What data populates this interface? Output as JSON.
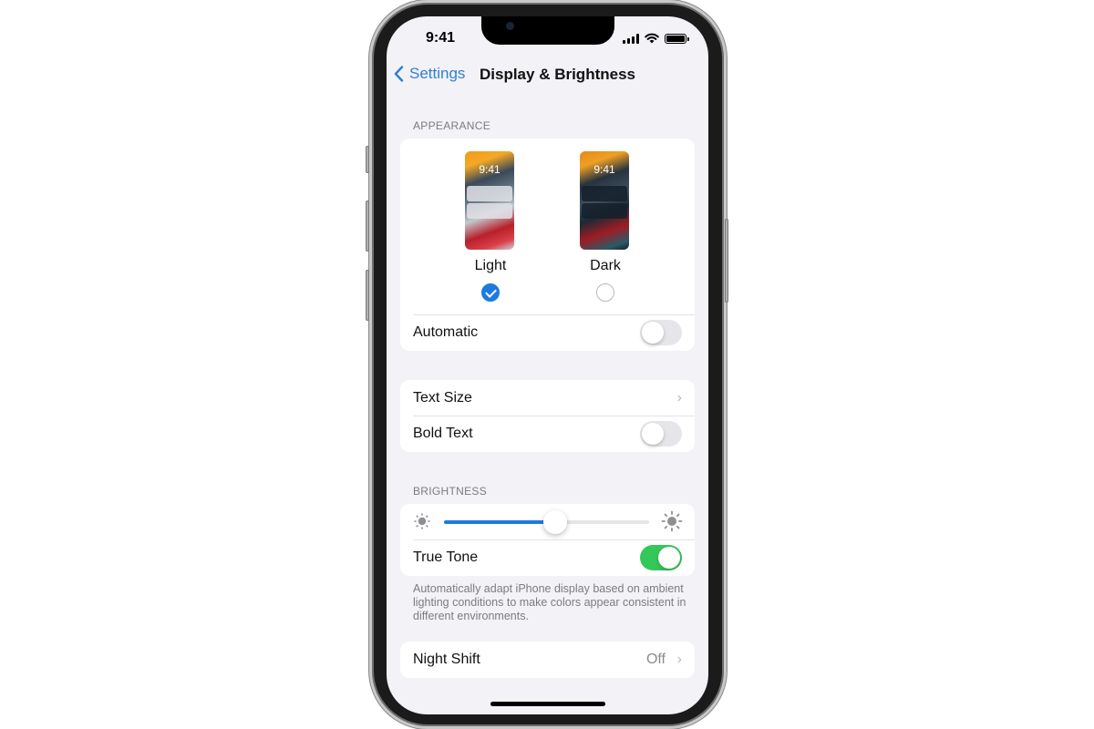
{
  "status_bar": {
    "time": "9:41",
    "icons": [
      "cellular-signal-icon",
      "wifi-icon",
      "battery-icon"
    ]
  },
  "nav": {
    "back_label": "Settings",
    "back_icon": "chevron-left-icon",
    "title": "Display & Brightness"
  },
  "appearance": {
    "header": "APPEARANCE",
    "options": [
      {
        "label": "Light",
        "preview_time": "9:41",
        "selected": true
      },
      {
        "label": "Dark",
        "preview_time": "9:41",
        "selected": false
      }
    ],
    "automatic": {
      "label": "Automatic",
      "enabled": false
    }
  },
  "text_group": {
    "text_size": {
      "label": "Text Size",
      "icon": "chevron-right-icon"
    },
    "bold_text": {
      "label": "Bold Text",
      "enabled": false
    }
  },
  "brightness": {
    "header": "BRIGHTNESS",
    "level_percent": 54,
    "min_icon": "sun-small-icon",
    "max_icon": "sun-large-icon",
    "true_tone": {
      "label": "True Tone",
      "enabled": true
    },
    "footer": "Automatically adapt iPhone display based on ambient lighting conditions to make colors appear consistent in different environments."
  },
  "night_shift": {
    "label": "Night Shift",
    "value": "Off",
    "icon": "chevron-right-icon"
  },
  "colors": {
    "accent": "#1f7ae0",
    "toggle_on": "#34c759",
    "background": "#f2f2f7"
  }
}
